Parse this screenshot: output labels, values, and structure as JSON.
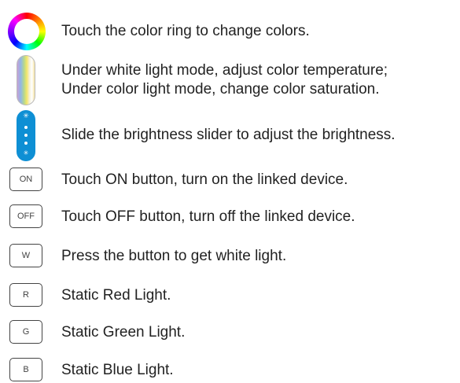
{
  "rows": [
    {
      "icon": "color-ring-icon",
      "text": "Touch the color ring to change colors."
    },
    {
      "icon": "color-temperature-slider-icon",
      "lines": [
        "Under white light mode, adjust color temperature;",
        "Under color light mode, change color saturation."
      ]
    },
    {
      "icon": "brightness-slider-icon",
      "text": "Slide the brightness slider to adjust the brightness."
    },
    {
      "button": "ON",
      "text": "Touch ON button, turn on the linked device."
    },
    {
      "button": "OFF",
      "text": "Touch OFF button, turn off the linked device."
    },
    {
      "button": "W",
      "text": "Press the button to get white light."
    },
    {
      "button": "R",
      "text": "Static Red Light."
    },
    {
      "button": "G",
      "text": "Static Green Light."
    },
    {
      "button": "B",
      "text": "Static Blue Light."
    }
  ],
  "colors": {
    "brightness_slider": "#0e8fd4",
    "button_border": "#444444",
    "text": "#222222"
  }
}
